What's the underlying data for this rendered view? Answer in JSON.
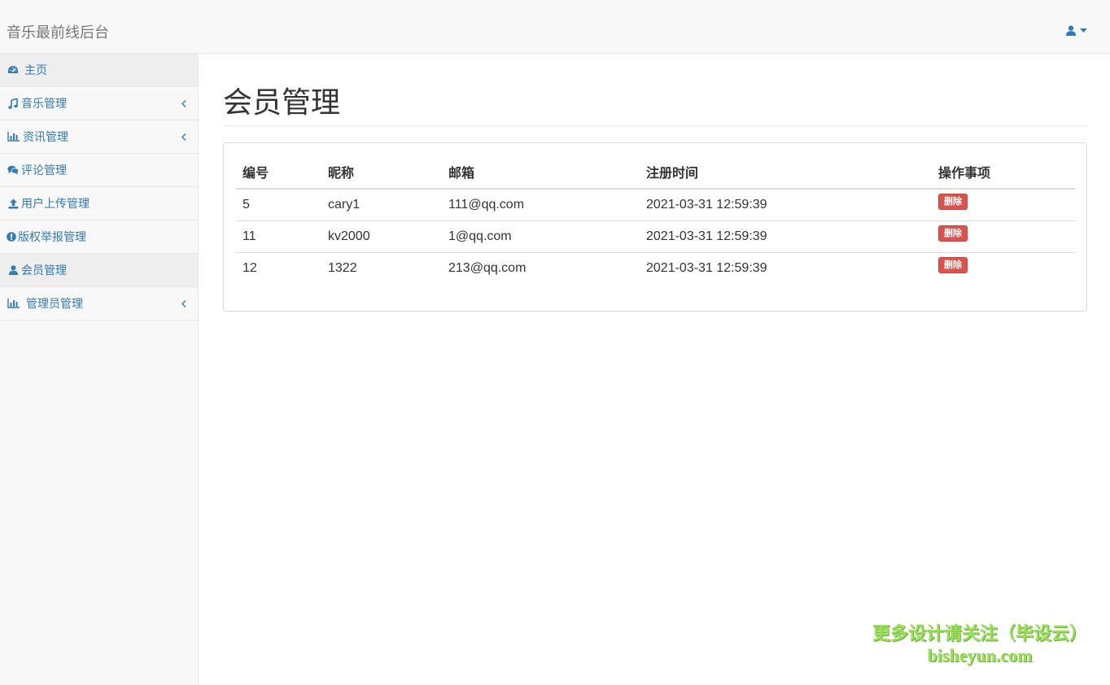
{
  "header": {
    "brand": "音乐最前线后台",
    "user_icon": "user-icon",
    "caret_icon": "caret-down-icon"
  },
  "sidebar": {
    "items": [
      {
        "label": "主页",
        "icon": "dashboard-icon",
        "active": true,
        "has_submenu": false
      },
      {
        "label": "音乐管理",
        "icon": "music-icon",
        "active": false,
        "has_submenu": true
      },
      {
        "label": "资讯管理",
        "icon": "bar-chart-icon",
        "active": false,
        "has_submenu": true
      },
      {
        "label": "评论管理",
        "icon": "comments-icon",
        "active": false,
        "has_submenu": false
      },
      {
        "label": "用户上传管理",
        "icon": "upload-icon",
        "active": false,
        "has_submenu": false
      },
      {
        "label": "版权举报管理",
        "icon": "exclamation-circle-icon",
        "active": false,
        "has_submenu": false
      },
      {
        "label": "会员管理",
        "icon": "user-icon",
        "active": true,
        "has_submenu": false
      },
      {
        "label": "管理员管理",
        "icon": "bar-chart-icon",
        "active": false,
        "has_submenu": true
      }
    ]
  },
  "main": {
    "title": "会员管理",
    "table": {
      "columns": [
        "编号",
        "昵称",
        "邮箱",
        "注册时间",
        "操作事项"
      ],
      "rows": [
        {
          "id": "5",
          "nickname": "cary1",
          "email": "111@qq.com",
          "registered": "2021-03-31 12:59:39",
          "action": "删除"
        },
        {
          "id": "11",
          "nickname": "kv2000",
          "email": "1@qq.com",
          "registered": "2021-03-31 12:59:39",
          "action": "删除"
        },
        {
          "id": "12",
          "nickname": "1322",
          "email": "213@qq.com",
          "registered": "2021-03-31 12:59:39",
          "action": "删除"
        }
      ]
    }
  },
  "watermark": {
    "line1": "更多设计请关注（毕设云）",
    "line2": "bisheyun.com"
  },
  "colors": {
    "link": "#337ab7",
    "danger": "#d9534f",
    "watermark": "#9be05a"
  }
}
